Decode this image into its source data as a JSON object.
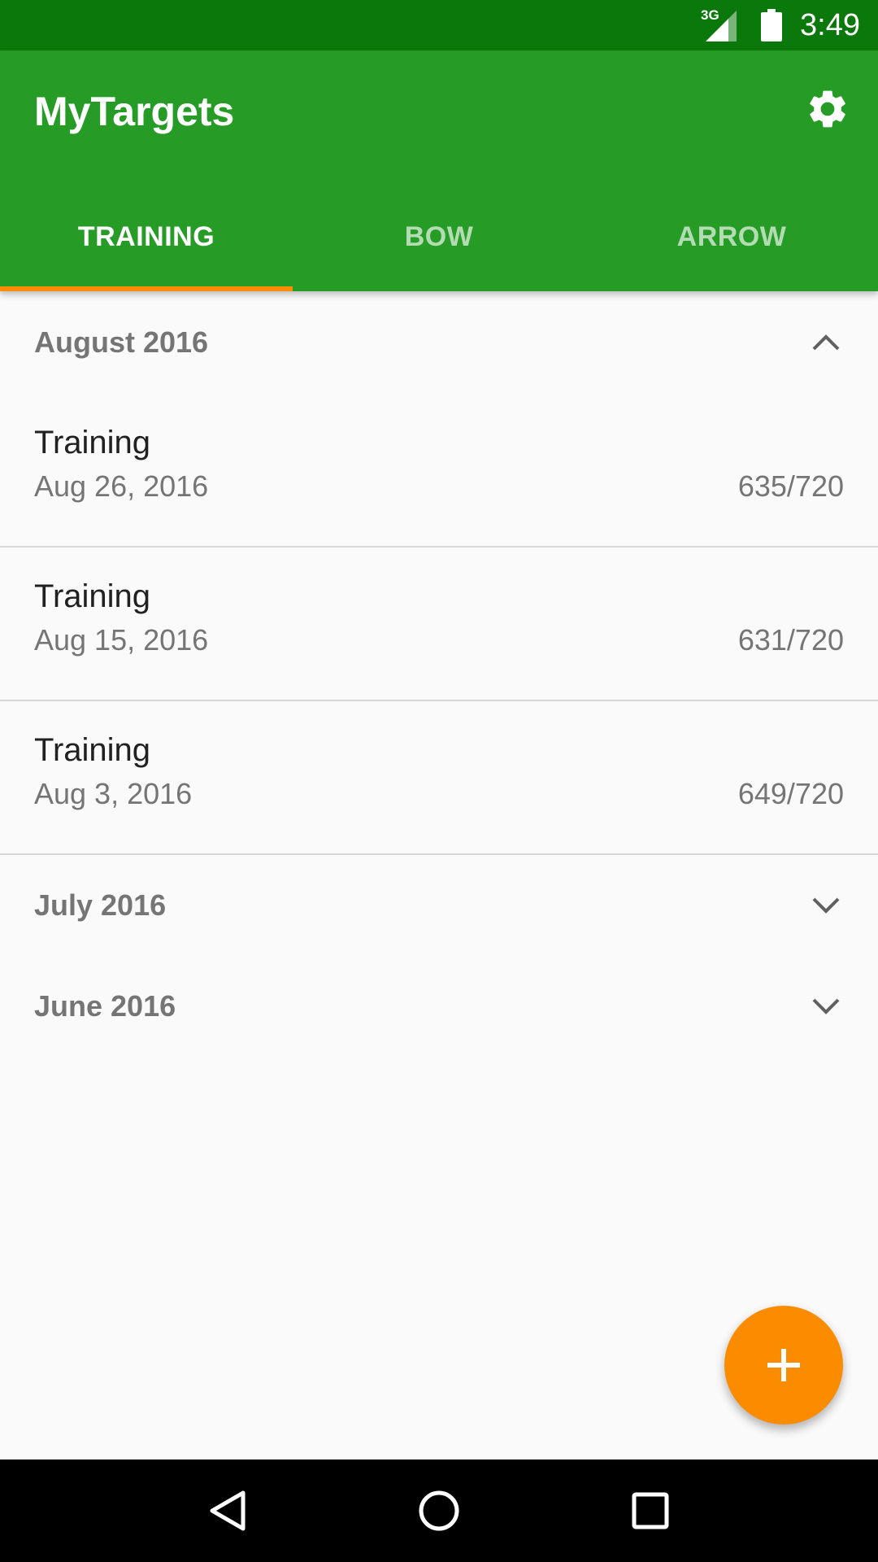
{
  "status_bar": {
    "network": "3G",
    "time": "3:49"
  },
  "app_bar": {
    "title": "MyTargets",
    "settings_icon": "gear-icon"
  },
  "tabs": [
    {
      "label": "TRAINING",
      "active": true
    },
    {
      "label": "BOW",
      "active": false
    },
    {
      "label": "ARROW",
      "active": false
    }
  ],
  "groups": [
    {
      "title": "August 2016",
      "expanded": true,
      "items": [
        {
          "title": "Training",
          "date": "Aug 26, 2016",
          "score": "635/720"
        },
        {
          "title": "Training",
          "date": "Aug 15, 2016",
          "score": "631/720"
        },
        {
          "title": "Training",
          "date": "Aug 3, 2016",
          "score": "649/720"
        }
      ]
    },
    {
      "title": "July 2016",
      "expanded": false
    },
    {
      "title": "June 2016",
      "expanded": false
    }
  ],
  "fab": {
    "icon": "plus-icon"
  },
  "nav_bar": {
    "icons": [
      "back-icon",
      "home-icon",
      "recents-icon"
    ]
  },
  "colors": {
    "status_bar": "#0b780b",
    "app_bar": "#269c26",
    "accent": "#fb8c00"
  }
}
